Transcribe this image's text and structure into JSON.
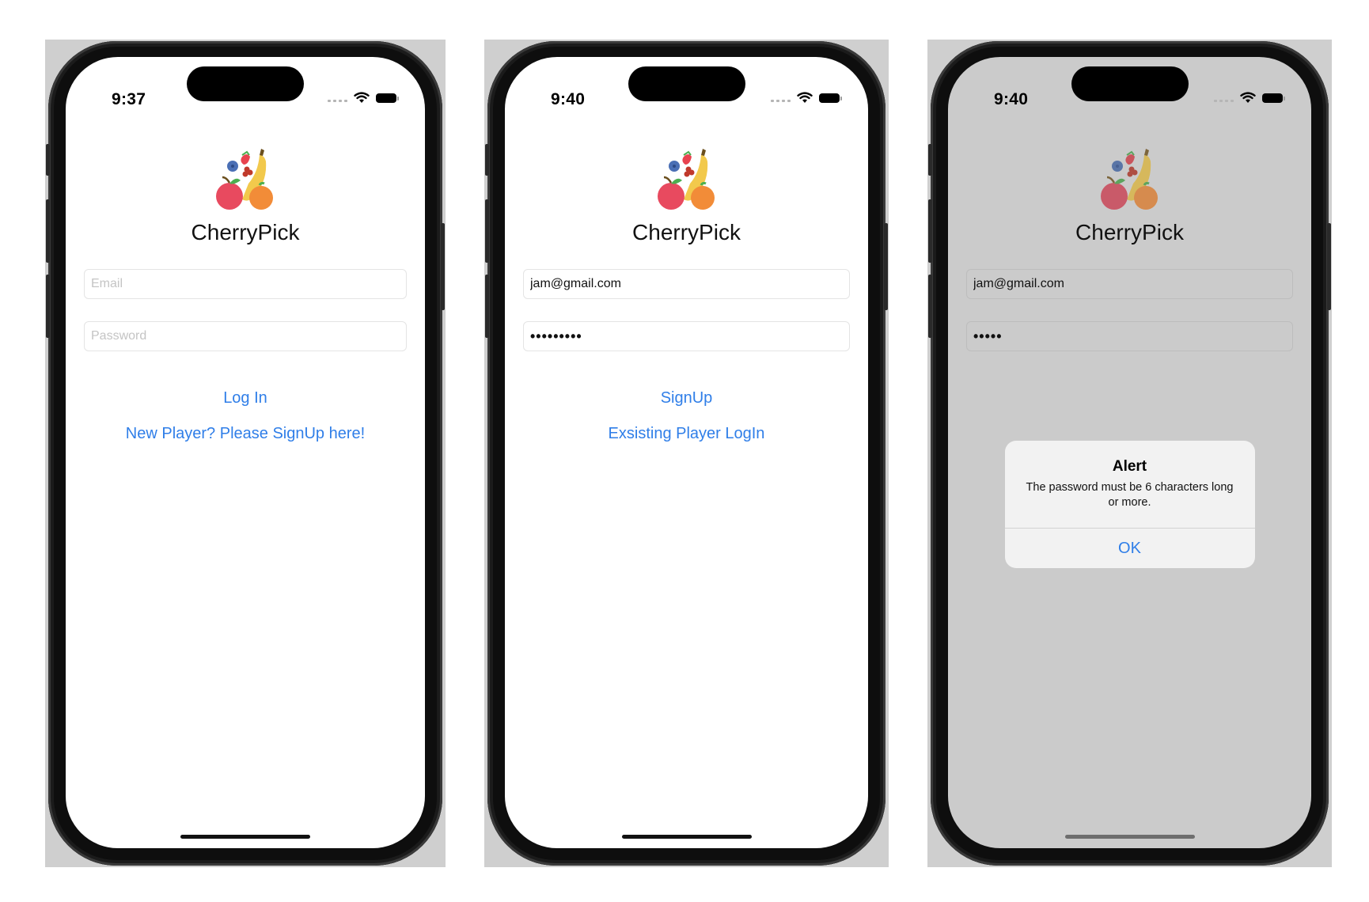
{
  "colors": {
    "accent": "#2f7ee8",
    "dimmed_background": "#cbcbcb",
    "device_frame": "#0e0e0e"
  },
  "app": {
    "name": "CherryPick",
    "logo_icon": "fruit-basket-icon"
  },
  "screens": [
    {
      "time": "9:37",
      "email_placeholder": "Email",
      "password_placeholder": "Password",
      "primary_button": "Log In",
      "secondary_link": "New Player? Please SignUp here!"
    },
    {
      "time": "9:40",
      "email_value": "jam@gmail.com",
      "password_value": "•••••••••",
      "primary_button": "SignUp",
      "secondary_link": "Exsisting Player LogIn"
    },
    {
      "time": "9:40",
      "email_value": "jam@gmail.com",
      "password_value": "•••••",
      "alert": {
        "title": "Alert",
        "message": "The password must be 6 characters long or more.",
        "button": "OK"
      }
    }
  ]
}
